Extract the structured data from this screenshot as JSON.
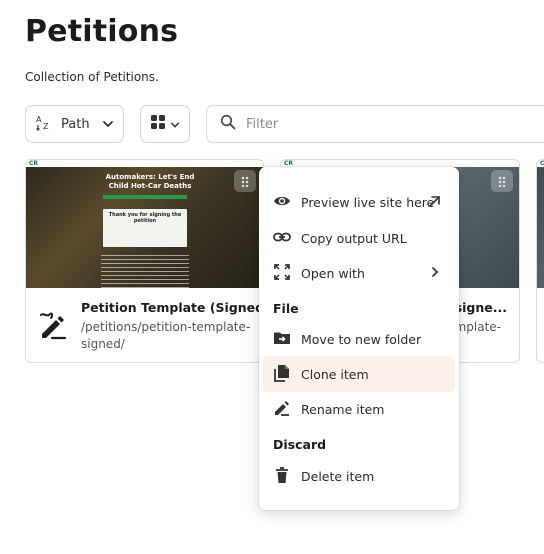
{
  "page": {
    "title": "Petitions",
    "description": "Collection of Petitions."
  },
  "toolbar": {
    "sort_label": "Path",
    "filter_placeholder": "Filter"
  },
  "cards": [
    {
      "name": "Petition Template (Signed)",
      "path": "/petitions/petition-template-signed/",
      "thumb_title": "Automakers: Let's End Child Hot-Car Deaths",
      "thumb_form_text": "Thank you for signing the petition"
    },
    {
      "name": "nsigne...",
      "path": "mplate-"
    }
  ],
  "context_menu": {
    "items": [
      {
        "label": "Preview live site here",
        "icon": "eye-icon"
      },
      {
        "label": "Copy output URL",
        "icon": "link-icon"
      },
      {
        "label": "Open with",
        "icon": "open-with-icon"
      }
    ],
    "file_header": "File",
    "file_items": [
      {
        "label": "Move to new folder",
        "icon": "folder-move-icon"
      },
      {
        "label": "Clone item",
        "icon": "clone-icon",
        "active": true
      },
      {
        "label": "Rename item",
        "icon": "rename-icon"
      }
    ],
    "discard_header": "Discard",
    "discard_items": [
      {
        "label": "Delete item",
        "icon": "trash-icon"
      }
    ]
  },
  "colors": {
    "active_item_bg": "#fcf1ea",
    "brand_green": "#1a7a3a"
  }
}
